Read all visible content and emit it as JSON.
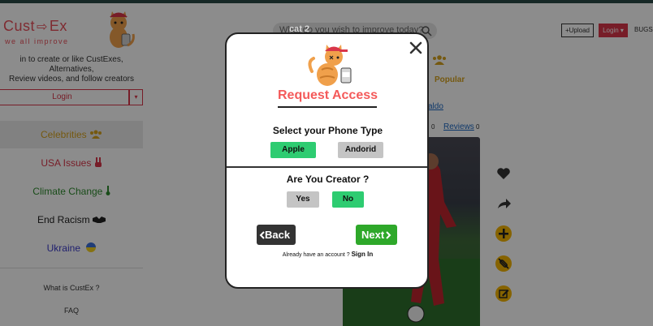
{
  "header": {
    "logo_text_left": "Cust",
    "logo_text_right": "Ex",
    "logo_arrow": "⇨",
    "logo_tagline": "we all improve",
    "search_placeholder": "What do you wish to improve today?",
    "upload_label": "+Upload",
    "login_label": "Login ▾",
    "bugs_label": "BUGS"
  },
  "sidebar": {
    "intro_line1": "in to create or like CustExes, Alternatives,",
    "intro_line2": "Review videos, and follow creators",
    "login_label": "Login",
    "login_caret": "▾",
    "items": [
      {
        "label": "Celebrities",
        "color": "#d6a21e",
        "active": true
      },
      {
        "label": "USA Issues",
        "color": "#d9364a",
        "active": false
      },
      {
        "label": "Climate Change",
        "color": "#2e8b2e",
        "active": false
      },
      {
        "label": "End Racism",
        "color": "#222222",
        "active": false
      },
      {
        "label": "Ukraine",
        "color": "#3b3bc9",
        "active": false
      }
    ],
    "footer_1": "What is CustEx ?",
    "footer_2": "FAQ"
  },
  "content": {
    "popular_label": "Popular",
    "creator_link": "aldo",
    "stat_zero": "0",
    "reviews_label": "Reviews",
    "reviews_count": "0"
  },
  "modal": {
    "ghost_label": "cat 2",
    "title": "Request Access",
    "phone_question": "Select your Phone Type",
    "phone_options": [
      "Apple",
      "Andorid"
    ],
    "phone_selected": "Apple",
    "creator_question": "Are You Creator ?",
    "creator_options": [
      "Yes",
      "No"
    ],
    "creator_selected": "No",
    "back_label": "Back",
    "next_label": "Next",
    "signin_prompt": "Already have an account ?",
    "signin_link": "Sign In"
  },
  "colors": {
    "brand_red": "#e8505b",
    "title_red": "#f45a5a",
    "green": "#2ecc71",
    "next_green": "#2ea82a",
    "back_dark": "#333333",
    "gold": "#d6a21e"
  }
}
